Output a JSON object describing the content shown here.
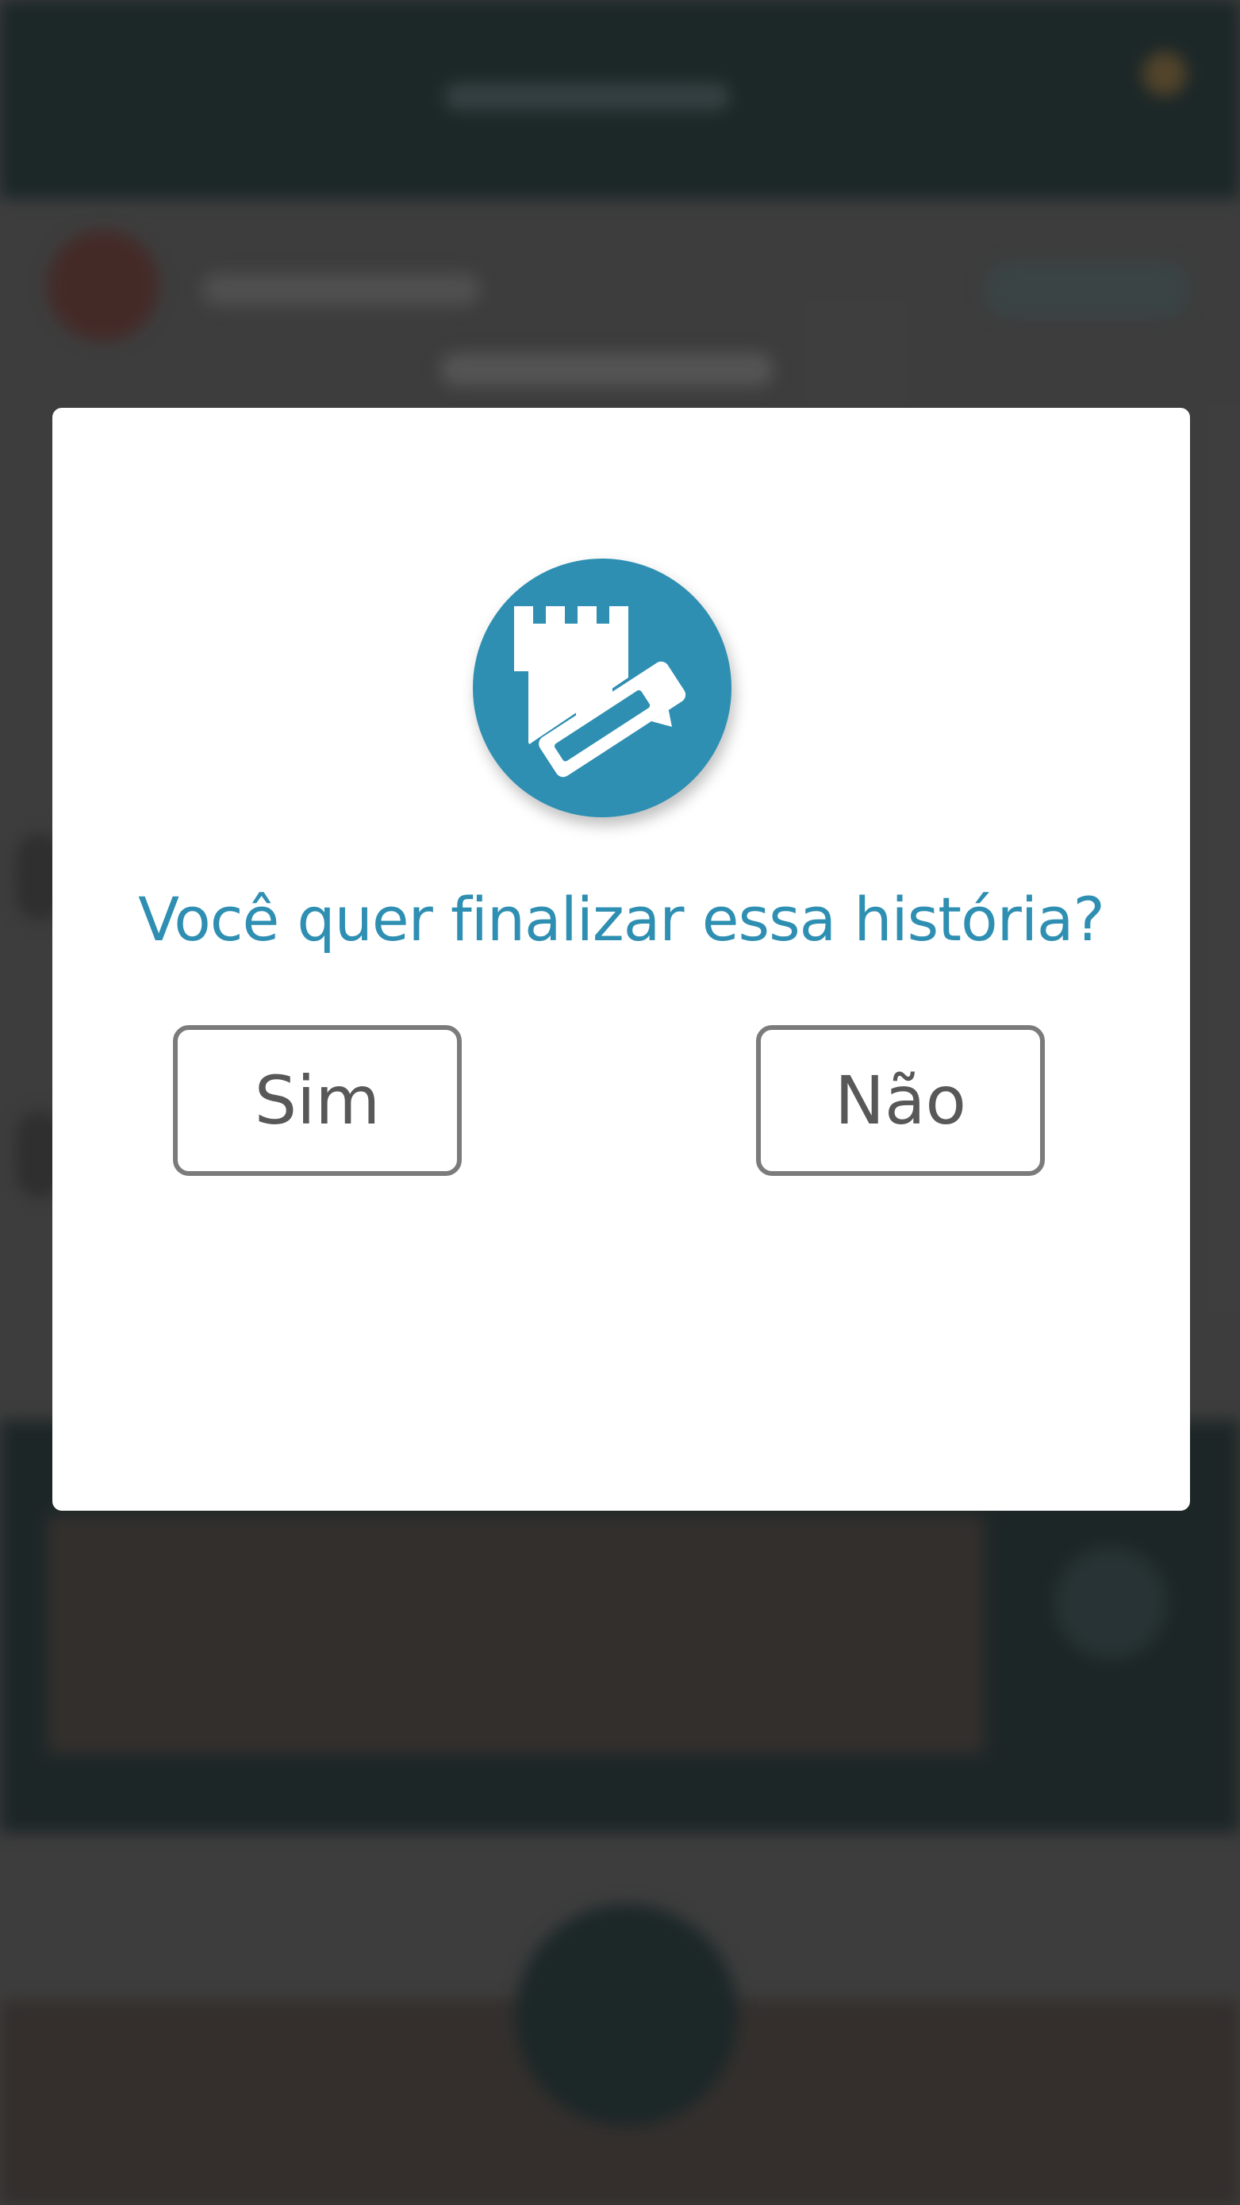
{
  "dialog": {
    "question": "Você quer finalizar essa história?",
    "yes_label": "Sim",
    "no_label": "Não",
    "icon": "castle-tower-pencil-icon"
  },
  "colors": {
    "accent": "#2e8fb2",
    "button_border": "#7c7b7c",
    "button_text": "#585858",
    "overlay": "#434343",
    "dialog_background": "#ffffff"
  }
}
